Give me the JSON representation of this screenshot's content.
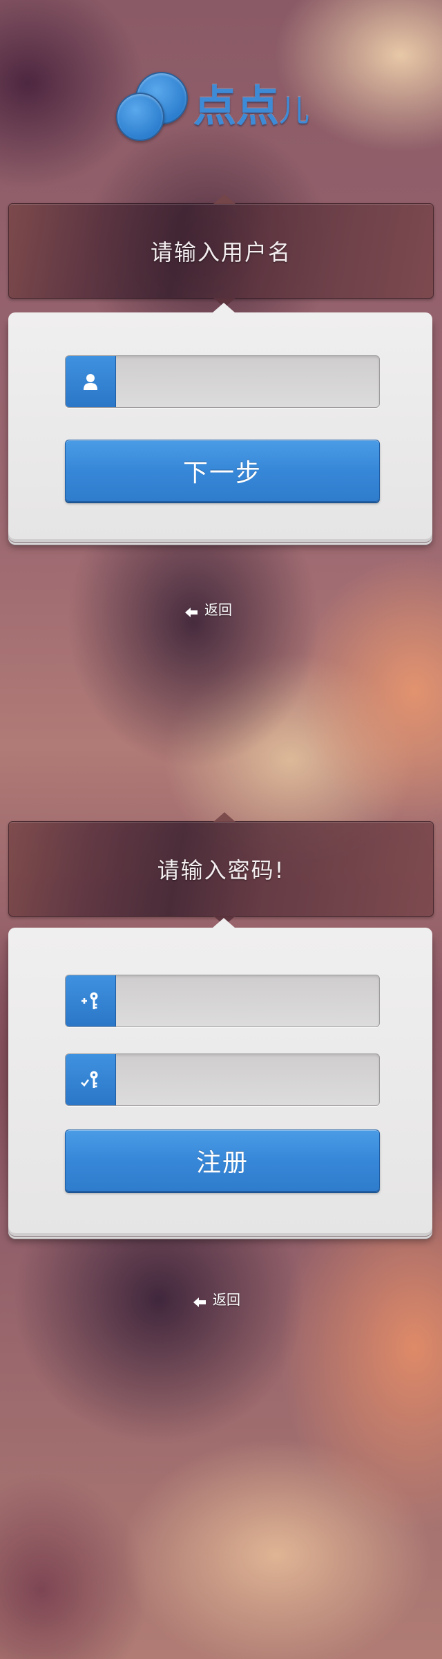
{
  "logo": {
    "text": "点点",
    "suffix": "儿"
  },
  "step_username": {
    "title": "请输入用户名",
    "username_input": {
      "value": "",
      "placeholder": ""
    },
    "next_label": "下一步",
    "back_label": "返回"
  },
  "step_password": {
    "title": "请输入密码!",
    "password_input": {
      "value": "",
      "placeholder": ""
    },
    "confirm_password_input": {
      "value": "",
      "placeholder": ""
    },
    "register_label": "注册",
    "back_label": "返回"
  },
  "icons": {
    "user": "user-icon",
    "add_key": "add-key-icon",
    "check_key": "check-key-icon",
    "back": "back-arrow-icon"
  },
  "colors": {
    "accent": "#3787d8",
    "accent_dark": "#2b76c7",
    "card": "#e9e8e8",
    "logo": "#3d8ad6"
  }
}
